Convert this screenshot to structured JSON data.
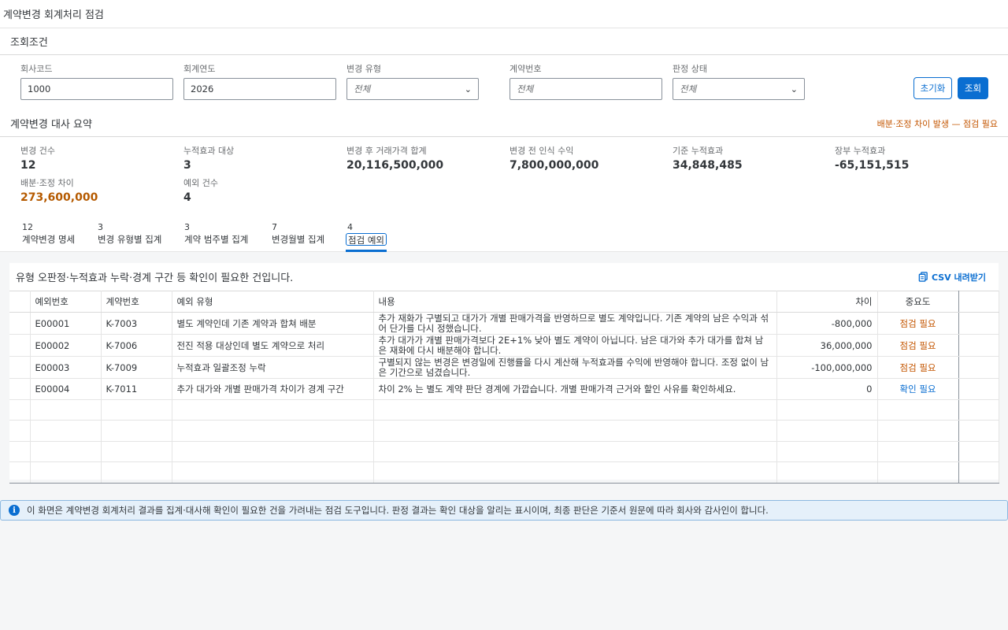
{
  "app": {
    "title": "계약변경 회계처리 점검"
  },
  "filters": {
    "title": "조회조건",
    "company_code": {
      "label": "회사코드",
      "value": "1000"
    },
    "fiscal_year": {
      "label": "회계연도",
      "value": "2026"
    },
    "change_type": {
      "label": "변경 유형",
      "value": "전체"
    },
    "contract_no": {
      "label": "계약번호",
      "placeholder": "전체"
    },
    "judgement_status": {
      "label": "판정 상태",
      "value": "전체"
    },
    "reset_label": "초기화",
    "search_label": "조회"
  },
  "summary": {
    "title": "계약변경 대사 요약",
    "alert": "배분·조정 차이 발생 — 점검 필요",
    "kpis": [
      {
        "label": "변경 건수",
        "value": "12"
      },
      {
        "label": "누적효과 대상",
        "value": "3"
      },
      {
        "label": "변경 후 거래가격 합계",
        "value": "20,116,500,000"
      },
      {
        "label": "변경 전 인식 수익",
        "value": "7,800,000,000"
      },
      {
        "label": "기준 누적효과",
        "value": "34,848,485"
      },
      {
        "label": "장부 누적효과",
        "value": "-65,151,515"
      },
      {
        "label": "배분·조정 차이",
        "value": "273,600,000"
      },
      {
        "label": "예외 건수",
        "value": "4"
      }
    ]
  },
  "tabs": [
    {
      "count": "12",
      "label": "계약변경 명세"
    },
    {
      "count": "3",
      "label": "변경 유형별 집계"
    },
    {
      "count": "3",
      "label": "계약 범주별 집계"
    },
    {
      "count": "7",
      "label": "변경월별 집계"
    },
    {
      "count": "4",
      "label": "점검 예외"
    }
  ],
  "exceptions": {
    "caption": "유형 오판정·누적효과 누락·경계 구간 등 확인이 필요한 건입니다.",
    "csv_label": "CSV 내려받기",
    "columns": [
      "예외번호",
      "계약번호",
      "예외 유형",
      "내용",
      "차이",
      "중요도"
    ],
    "rows": [
      {
        "id": "E00001",
        "contract": "K-7003",
        "type": "별도 계약인데 기존 계약과 합쳐 배분",
        "desc": "추가 재화가 구별되고 대가가 개별 판매가격을 반영하므로 별도 계약입니다. 기존 계약의 남은 수익과 섞어 단가를 다시 정했습니다.",
        "diff": "-800,000",
        "severity": "점검 필요"
      },
      {
        "id": "E00002",
        "contract": "K-7006",
        "type": "전진 적용 대상인데 별도 계약으로 처리",
        "desc": "추가 대가가 개별 판매가격보다 2E+1% 낮아 별도 계약이 아닙니다. 남은 대가와 추가 대가를 합쳐 남은 재화에 다시 배분해야 합니다.",
        "diff": "36,000,000",
        "severity": "점검 필요"
      },
      {
        "id": "E00003",
        "contract": "K-7009",
        "type": "누적효과 일괄조정 누락",
        "desc": "구별되지 않는 변경은 변경일에 진행률을 다시 계산해 누적효과를 수익에 반영해야 합니다. 조정 없이 남은 기간으로 넘겼습니다.",
        "diff": "-100,000,000",
        "severity": "점검 필요"
      },
      {
        "id": "E00004",
        "contract": "K-7011",
        "type": "추가 대가와 개별 판매가격 차이가 경계 구간",
        "desc": "차이 2% 는 별도 계약 판단 경계에 가깝습니다. 개별 판매가격 근거와 할인 사유를 확인하세요.",
        "diff": "0",
        "severity": "확인 필요"
      }
    ]
  },
  "info": {
    "text": "이 화면은 계약변경 회계처리 결과를 집계·대사해 확인이 필요한 건을 가려내는 점검 도구입니다. 판정 결과는 확인 대상을 알리는 표시이며, 최종 판단은 기준서 원문에 따라 회사와 감사인이 합니다."
  },
  "colors": {
    "accent": "#0a6ed1",
    "warning": "#c35500",
    "kpi_alert": "#b55a00"
  }
}
